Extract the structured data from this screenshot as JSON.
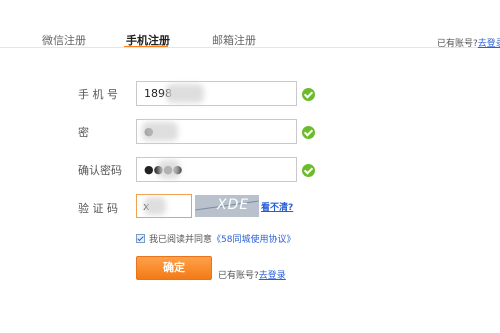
{
  "tabs": [
    {
      "label": "微信注册",
      "active": false
    },
    {
      "label": "手机注册",
      "active": true
    },
    {
      "label": "邮箱注册",
      "active": false
    }
  ],
  "top_login": {
    "prefix": "已有账号?",
    "link": "去登录"
  },
  "form": {
    "phone": {
      "label": "手 机 号",
      "value": "1898"
    },
    "password": {
      "label": "密 码",
      "value": "●"
    },
    "confirm_password": {
      "label": "确认密码",
      "value": "●●●●"
    },
    "captcha": {
      "label": "验 证 码",
      "value": "x",
      "image_text": "XDE",
      "hint": "看不清?"
    }
  },
  "agreement": {
    "checked": true,
    "prefix": "我已阅读并同意",
    "link": "《58同城使用协议》"
  },
  "submit_label": "确定",
  "bottom_login": {
    "prefix": "已有账号?",
    "link": "去登录"
  },
  "colors": {
    "accent": "#ff7d1a",
    "link": "#2a5ed6",
    "success": "#6bbb2b"
  },
  "icons": {
    "valid": "check-circle-icon"
  }
}
